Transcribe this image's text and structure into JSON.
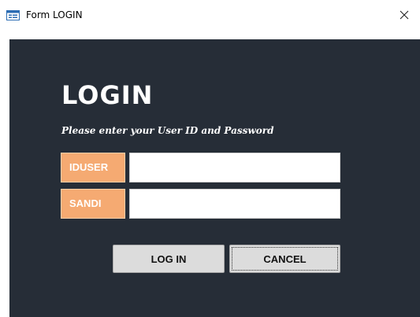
{
  "window": {
    "title": "Form LOGIN",
    "icon": "form-icon",
    "close_icon": "close-icon"
  },
  "form": {
    "heading": "LOGIN",
    "subheading": "Please enter your User ID and Password",
    "user_label": "IDUSER",
    "user_value": "",
    "password_label": "SANDI",
    "password_value": ""
  },
  "buttons": {
    "login_label": "LOG IN",
    "cancel_label": "CANCEL"
  },
  "colors": {
    "background": "#262d37",
    "label_fill": "#f5aa72",
    "heading_text": "#ffffff"
  }
}
